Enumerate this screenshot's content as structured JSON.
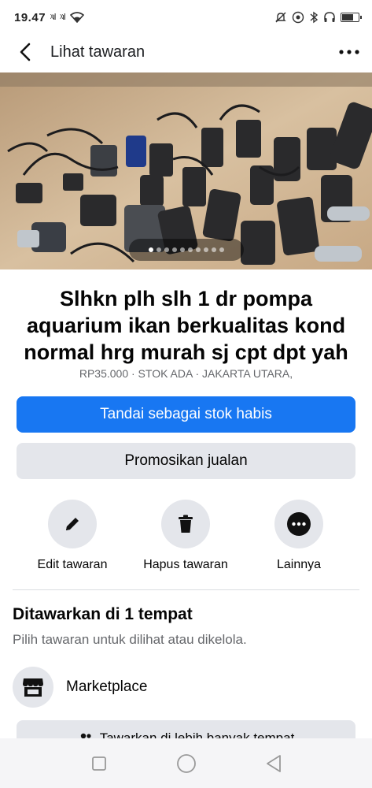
{
  "status_bar": {
    "time": "19.47",
    "signal_1": "ᵡıl",
    "signal_2": "ᵡıl",
    "icons": [
      "mute-icon",
      "data-icon",
      "bluetooth-icon",
      "headset-icon",
      "battery-icon"
    ],
    "battery_level": 0.75
  },
  "topbar": {
    "title": "Lihat tawaran"
  },
  "listing": {
    "photo_count": 10,
    "active_photo_index": 0,
    "title": "Slhkn plh slh 1 dr pompa aquarium ikan berkualitas kond normal hrg murah sj cpt dpt yah",
    "meta": "RP35.000 · STOK ADA · JAKARTA UTARA,"
  },
  "buttons": {
    "mark_sold": "Tandai sebagai stok habis",
    "promote": "Promosikan jualan"
  },
  "actions": [
    {
      "label": "Edit tawaran",
      "icon": "pencil-icon"
    },
    {
      "label": "Hapus tawaran",
      "icon": "trash-icon"
    },
    {
      "label": "Lainnya",
      "icon": "more-icon"
    }
  ],
  "offered": {
    "title": "Ditawarkan di 1 tempat",
    "subtitle": "Pilih tawaran untuk dilihat atau dikelola.",
    "place": "Marketplace",
    "more_places_button": "Tawarkan di lebih banyak tempat"
  },
  "colors": {
    "primary": "#1877f2",
    "secondary_bg": "#e4e6eb",
    "muted_text": "#65676b"
  }
}
